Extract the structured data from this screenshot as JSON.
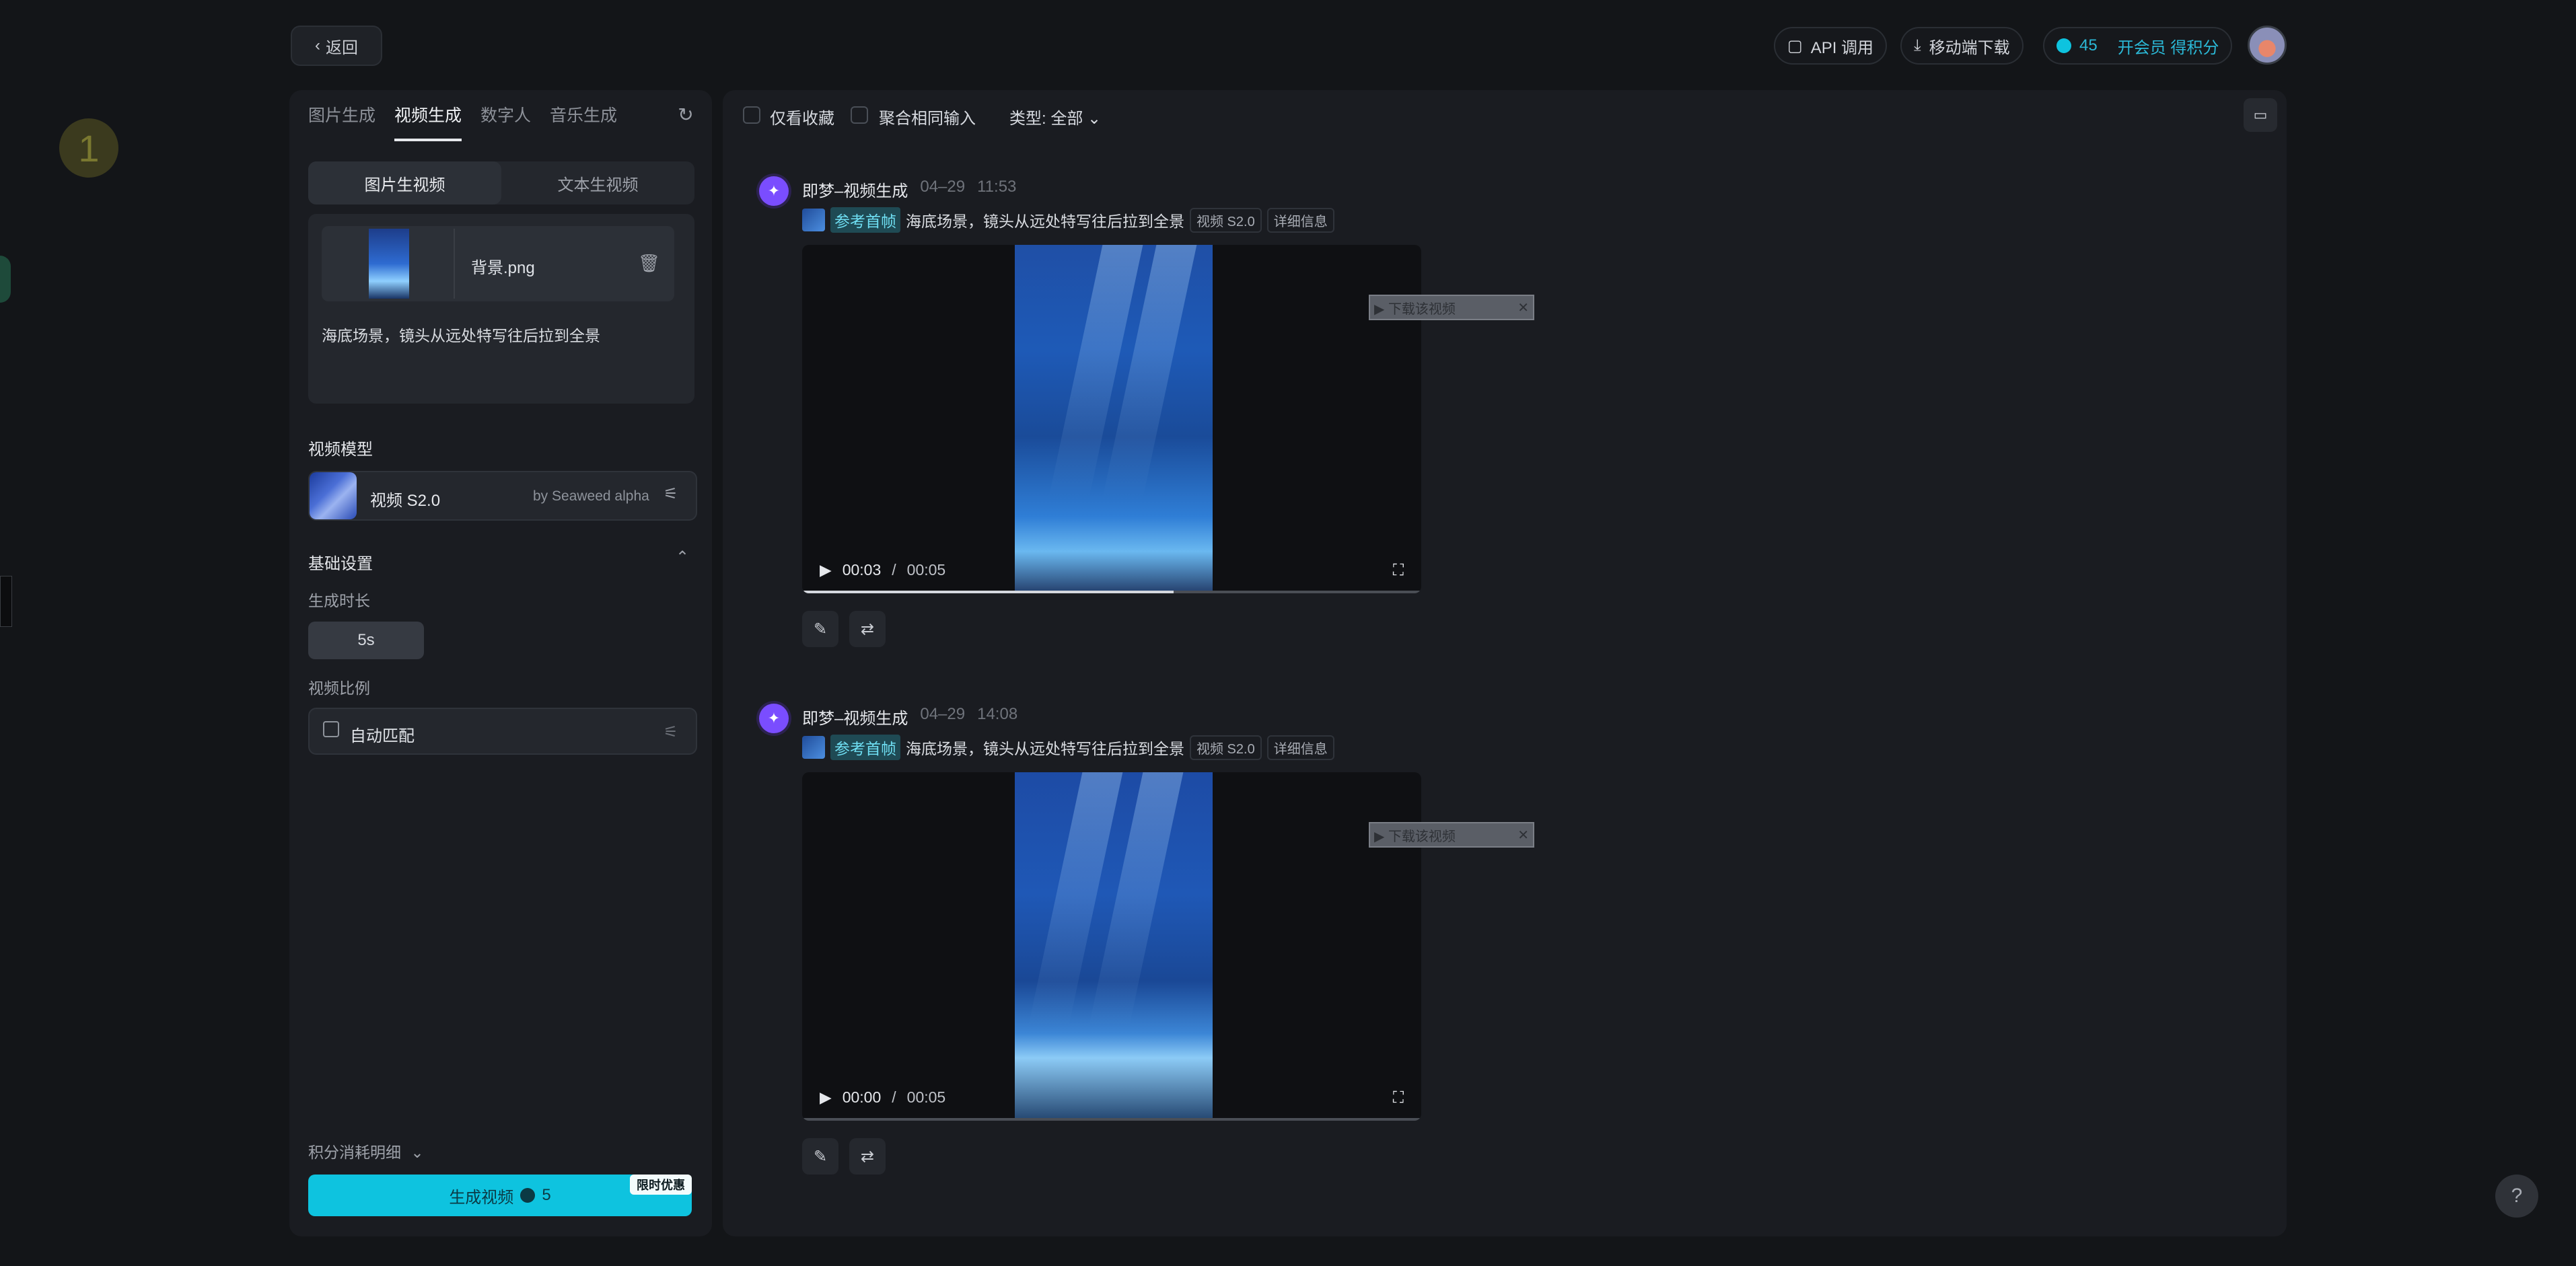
{
  "header": {
    "back_label": "返回",
    "api_label": "API 调用",
    "mobile_label": "移动端下载",
    "credits": "45",
    "member_label": "开会员 得积分"
  },
  "left": {
    "tabs": [
      "图片生成",
      "视频生成",
      "数字人",
      "音乐生成"
    ],
    "active_tab": "视频生成",
    "sub_tabs": [
      "图片生视频",
      "文本生视频"
    ],
    "file_name": "背景.png",
    "prompt": "海底场景，镜头从远处特写往后拉到全景",
    "model_section": "视频模型",
    "model_name": "视频 S2.0",
    "model_by": "by Seaweed alpha",
    "basic_settings": "基础设置",
    "duration_label": "生成时长",
    "duration_value": "5s",
    "ratio_label": "视频比例",
    "ratio_value": "自动匹配",
    "cost_detail": "积分消耗明细",
    "generate_label": "生成视频",
    "generate_cost": "5",
    "promo": "限时优惠"
  },
  "filters": {
    "favorites_only": "仅看收藏",
    "merge_same": "聚合相同输入",
    "type_label": "类型: 全部"
  },
  "results": [
    {
      "title": "即梦–视频生成",
      "date": "04–29",
      "time": "11:53",
      "ref_label": "参考首帧",
      "prompt": "海底场景，镜头从远处特写往后拉到全景",
      "model_chip": "视频 S2.0",
      "detail_chip": "详细信息",
      "current": "00:03",
      "sep": "/",
      "duration": "00:05",
      "progress": 0.6,
      "overlay": "▶ 下载该视频"
    },
    {
      "title": "即梦–视频生成",
      "date": "04–29",
      "time": "14:08",
      "ref_label": "参考首帧",
      "prompt": "海底场景，镜头从远处特写往后拉到全景",
      "model_chip": "视频 S2.0",
      "detail_chip": "详细信息",
      "current": "00:00",
      "sep": "/",
      "duration": "00:05",
      "progress": 0,
      "overlay": "▶ 下载该视频"
    }
  ],
  "help": "?",
  "deco_number": "1"
}
